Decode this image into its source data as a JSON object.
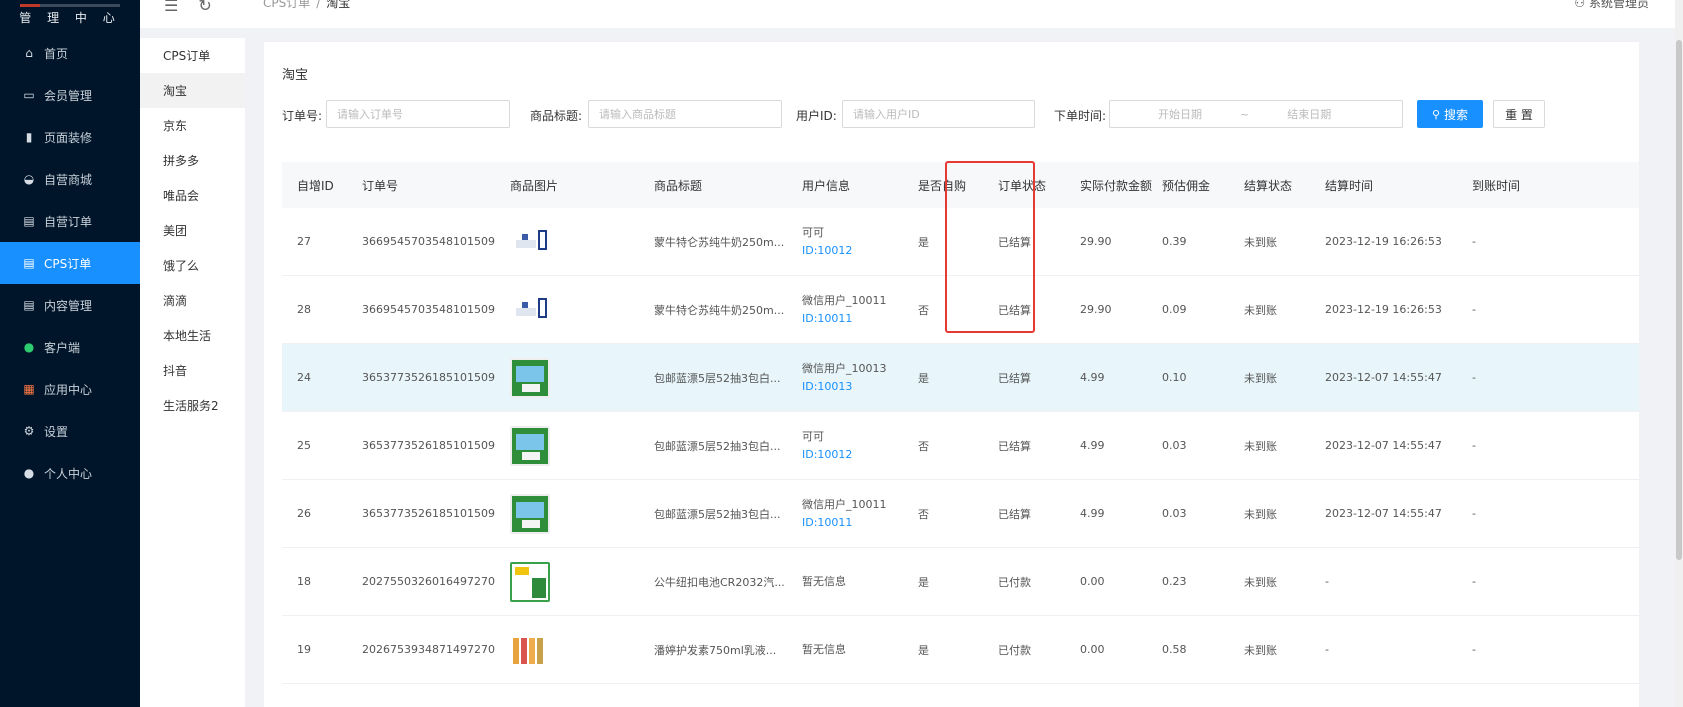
{
  "sidebar": {
    "logo_text": "管 理 中 心",
    "items": [
      {
        "label": "首页",
        "icon": "home-icon"
      },
      {
        "label": "会员管理",
        "icon": "member-card-icon"
      },
      {
        "label": "页面装修",
        "icon": "bar-chart-icon"
      },
      {
        "label": "自营商城",
        "icon": "shopping-bag-icon"
      },
      {
        "label": "自营订单",
        "icon": "order-doc-icon"
      },
      {
        "label": "CPS订单",
        "icon": "order-doc-icon",
        "active": true
      },
      {
        "label": "内容管理",
        "icon": "content-doc-icon"
      },
      {
        "label": "客户端",
        "icon": "wechat-icon"
      },
      {
        "label": "应用中心",
        "icon": "apps-grid-icon"
      },
      {
        "label": "设置",
        "icon": "gear-icon"
      },
      {
        "label": "个人中心",
        "icon": "user-icon"
      }
    ]
  },
  "topbar": {
    "breadcrumb": [
      "CPS订单",
      "淘宝"
    ],
    "admin_label": "系统管理员"
  },
  "subnav": {
    "items": [
      "CPS订单",
      "淘宝",
      "京东",
      "拼多多",
      "唯品会",
      "美团",
      "饿了么",
      "滴滴",
      "本地生活",
      "抖音",
      "生活服务2"
    ],
    "active_index": 1
  },
  "main": {
    "title": "淘宝",
    "filters": {
      "order_no_label": "订单号:",
      "order_no_placeholder": "请输入订单号",
      "goods_title_label": "商品标题:",
      "goods_title_placeholder": "请输入商品标题",
      "user_id_label": "用户ID:",
      "user_id_placeholder": "请输入用户ID",
      "order_time_label": "下单时间:",
      "start_date_placeholder": "开始日期",
      "range_sep": "~",
      "end_date_placeholder": "结束日期",
      "search_label": "搜索",
      "reset_label": "重 置"
    },
    "table": {
      "headers": [
        "自增ID",
        "订单号",
        "商品图片",
        "商品标题",
        "用户信息",
        "是否自购",
        "订单状态",
        "实际付款金额",
        "预估佣金",
        "结算状态",
        "结算时间",
        "到账时间"
      ],
      "rows": [
        {
          "id": "27",
          "order_no": "3669545703548101509",
          "img": "milk",
          "title": "蒙牛特仑苏纯牛奶250m...",
          "user_name": "可可",
          "user_id": "ID:10012",
          "self_buy": "是",
          "status": "已结算",
          "amount": "29.90",
          "commission": "0.39",
          "settle_status": "未到账",
          "settle_time": "2023-12-19 16:26:53",
          "arrive_time": "-"
        },
        {
          "id": "28",
          "order_no": "3669545703548101509",
          "img": "milk",
          "title": "蒙牛特仑苏纯牛奶250m...",
          "user_name": "微信用户_10011",
          "user_id": "ID:10011",
          "self_buy": "否",
          "status": "已结算",
          "amount": "29.90",
          "commission": "0.09",
          "settle_status": "未到账",
          "settle_time": "2023-12-19 16:26:53",
          "arrive_time": "-"
        },
        {
          "id": "24",
          "order_no": "3653773526185101509",
          "img": "tissue",
          "title": "包邮蓝漂5层52抽3包白...",
          "user_name": "微信用户_10013",
          "user_id": "ID:10013",
          "self_buy": "是",
          "status": "已结算",
          "amount": "4.99",
          "commission": "0.10",
          "settle_status": "未到账",
          "settle_time": "2023-12-07 14:55:47",
          "arrive_time": "-",
          "highlight": true
        },
        {
          "id": "25",
          "order_no": "3653773526185101509",
          "img": "tissue",
          "title": "包邮蓝漂5层52抽3包白...",
          "user_name": "可可",
          "user_id": "ID:10012",
          "self_buy": "否",
          "status": "已结算",
          "amount": "4.99",
          "commission": "0.03",
          "settle_status": "未到账",
          "settle_time": "2023-12-07 14:55:47",
          "arrive_time": "-"
        },
        {
          "id": "26",
          "order_no": "3653773526185101509",
          "img": "tissue",
          "title": "包邮蓝漂5层52抽3包白...",
          "user_name": "微信用户_10011",
          "user_id": "ID:10011",
          "self_buy": "否",
          "status": "已结算",
          "amount": "4.99",
          "commission": "0.03",
          "settle_status": "未到账",
          "settle_time": "2023-12-07 14:55:47",
          "arrive_time": "-"
        },
        {
          "id": "18",
          "order_no": "2027550326016497270",
          "img": "battery",
          "title": "公牛纽扣电池CR2032汽...",
          "user_name": "暂无信息",
          "user_id": "",
          "self_buy": "是",
          "status": "已付款",
          "amount": "0.00",
          "commission": "0.23",
          "settle_status": "未到账",
          "settle_time": "-",
          "arrive_time": "-"
        },
        {
          "id": "19",
          "order_no": "2026753934871497270",
          "img": "shampoo",
          "title": "潘婷护发素750ml乳液...",
          "user_name": "暂无信息",
          "user_id": "",
          "self_buy": "是",
          "status": "已付款",
          "amount": "0.00",
          "commission": "0.58",
          "settle_status": "未到账",
          "settle_time": "-",
          "arrive_time": "-"
        }
      ]
    }
  }
}
